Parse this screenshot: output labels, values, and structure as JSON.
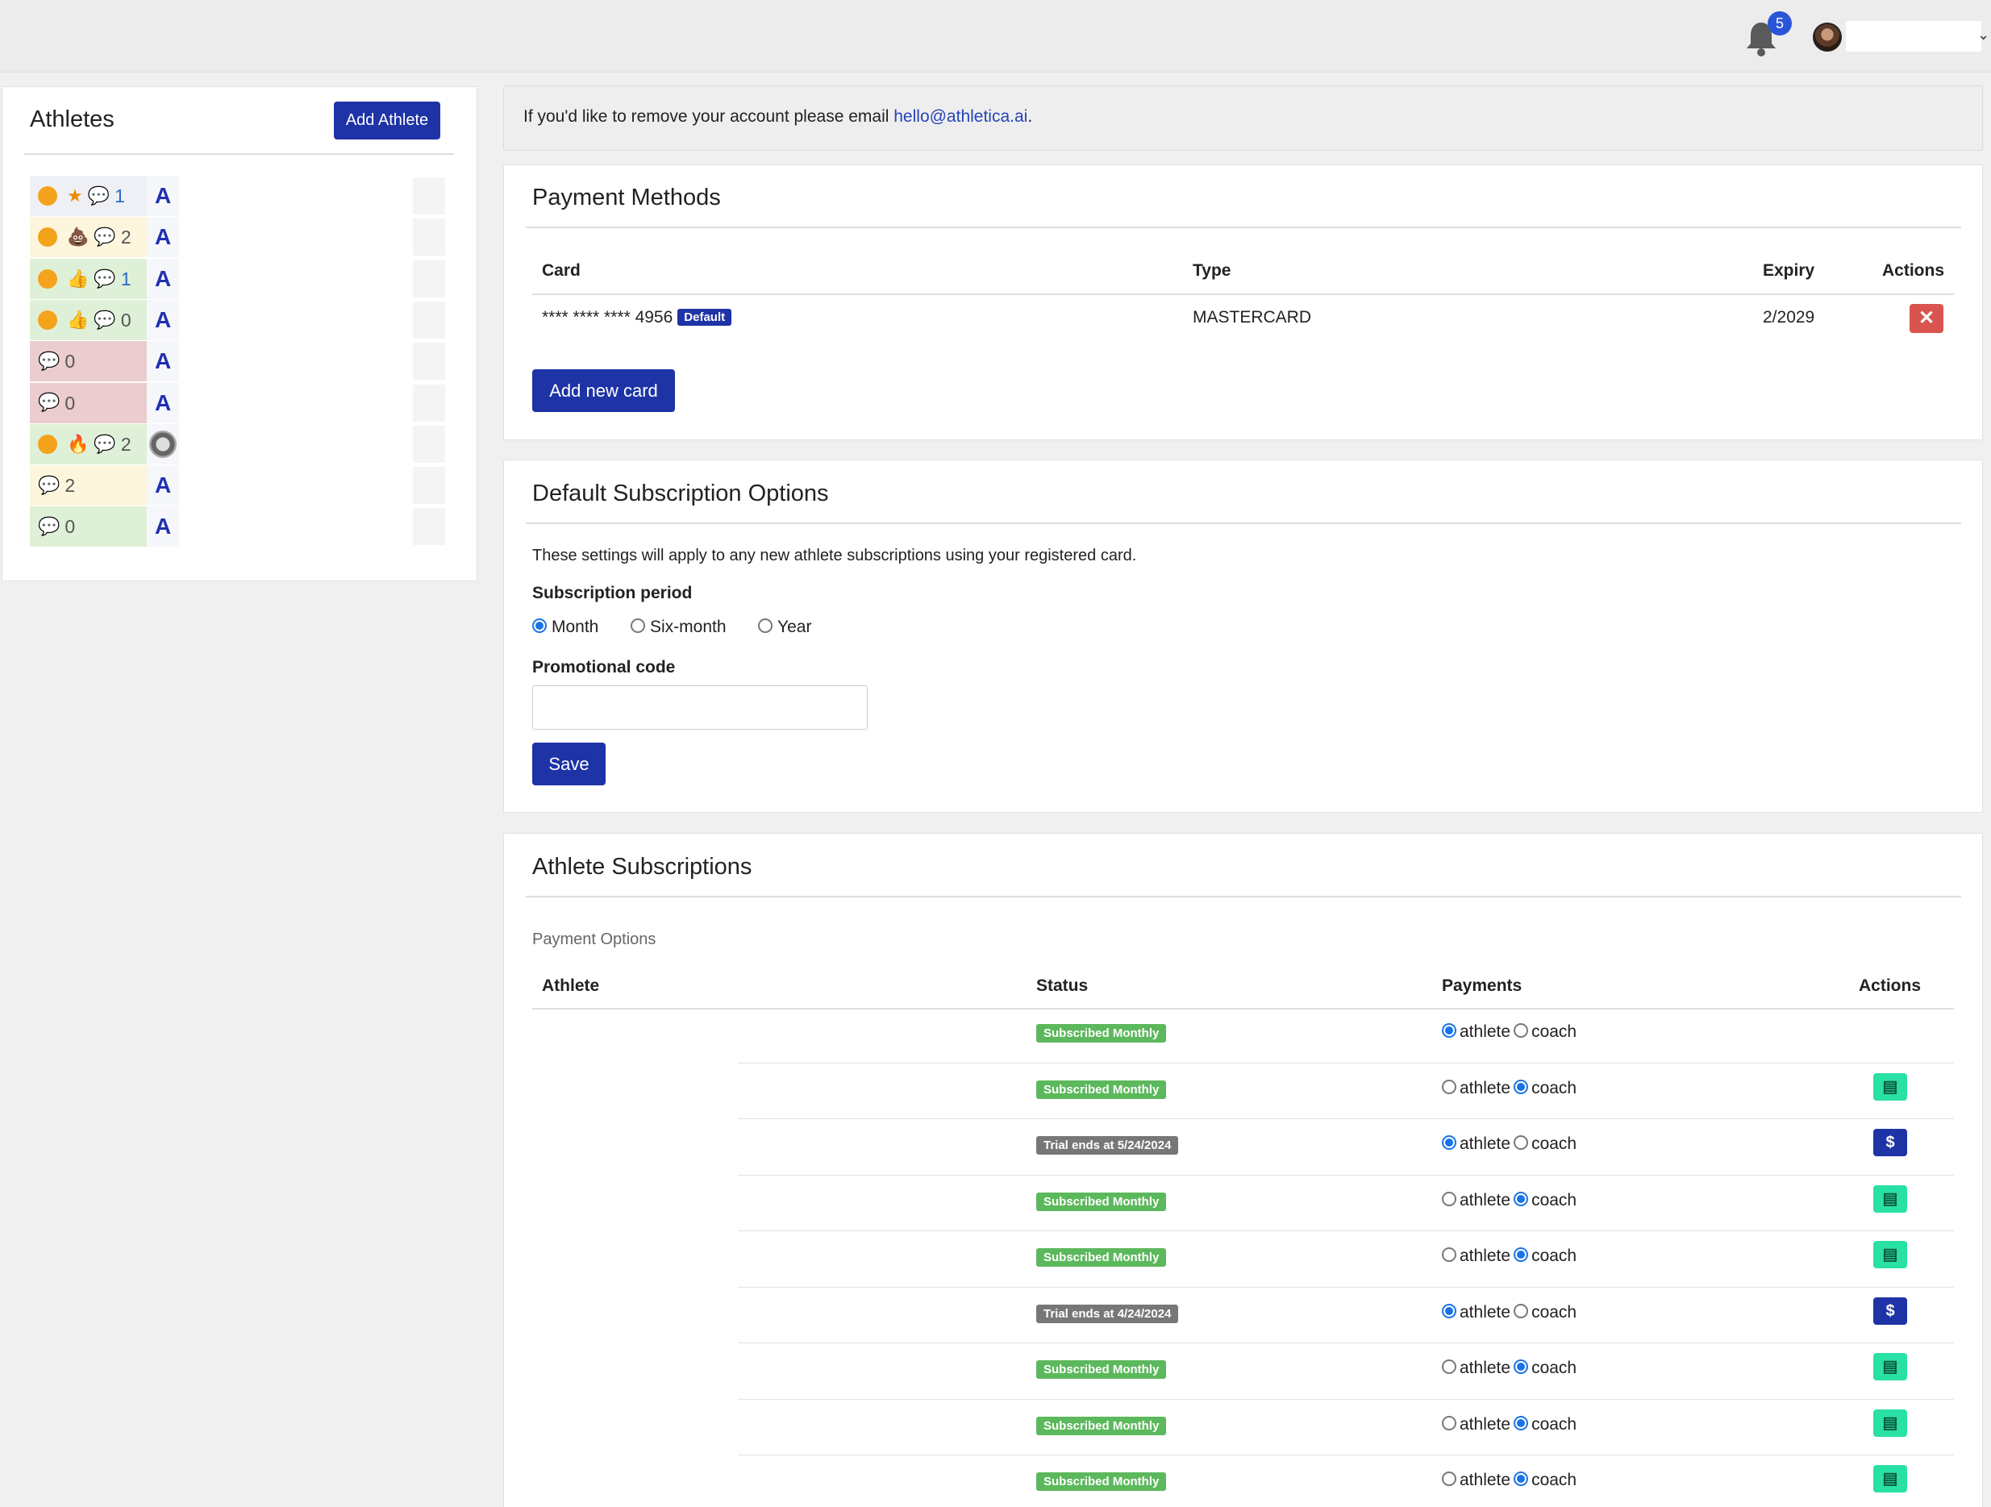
{
  "topbar": {
    "notifications_count": "5"
  },
  "sidebar": {
    "title": "Athletes",
    "add_button": "Add Athlete",
    "rows": [
      {
        "count": "1",
        "bg": "#eef0f6"
      },
      {
        "count": "2",
        "bg": "#fdf6dd"
      },
      {
        "count": "1",
        "bg": "#dff0d8"
      },
      {
        "count": "0",
        "bg": "#dff0d8"
      },
      {
        "count": "0",
        "bg": "#ebcccf"
      },
      {
        "count": "0",
        "bg": "#ebcccf"
      },
      {
        "count": "2",
        "bg": "#dff0d8"
      },
      {
        "count": "2",
        "bg": "#fdf6dd"
      },
      {
        "count": "0",
        "bg": "#dff0d8"
      }
    ]
  },
  "alert": {
    "text": "If you'd like to remove your account please email ",
    "email": "hello@athletica.ai",
    "suffix": "."
  },
  "payment_methods": {
    "title": "Payment Methods",
    "headers": {
      "card": "Card",
      "type": "Type",
      "expiry": "Expiry",
      "actions": "Actions"
    },
    "card_number": "**** **** **** 4956",
    "default_badge": "Default",
    "card_type": "MASTERCARD",
    "expiry": "2/2029",
    "add_card": "Add new card"
  },
  "default_subscription": {
    "title": "Default Subscription Options",
    "description": "These settings will apply to any new athlete subscriptions using your registered card.",
    "period_label": "Subscription period",
    "options": [
      "Month",
      "Six-month",
      "Year"
    ],
    "selected": "Month",
    "promo_label": "Promotional code",
    "promo_value": "",
    "save": "Save"
  },
  "athlete_subscriptions": {
    "title": "Athlete Subscriptions",
    "subtitle": "Payment Options",
    "headers": {
      "athlete": "Athlete",
      "status": "Status",
      "payments": "Payments",
      "actions": "Actions"
    },
    "payment_labels": {
      "athlete": "athlete",
      "coach": "coach"
    },
    "rows": [
      {
        "status": "Subscribed Monthly",
        "kind": "sub",
        "payer": "athlete",
        "action": "none"
      },
      {
        "status": "Subscribed Monthly",
        "kind": "sub",
        "payer": "coach",
        "action": "doc"
      },
      {
        "status": "Trial ends at 5/24/2024",
        "kind": "trial",
        "payer": "athlete",
        "action": "pay"
      },
      {
        "status": "Subscribed Monthly",
        "kind": "sub",
        "payer": "coach",
        "action": "doc"
      },
      {
        "status": "Subscribed Monthly",
        "kind": "sub",
        "payer": "coach",
        "action": "doc"
      },
      {
        "status": "Trial ends at 4/24/2024",
        "kind": "trial",
        "payer": "athlete",
        "action": "pay"
      },
      {
        "status": "Subscribed Monthly",
        "kind": "sub",
        "payer": "coach",
        "action": "doc"
      },
      {
        "status": "Subscribed Monthly",
        "kind": "sub",
        "payer": "coach",
        "action": "doc"
      },
      {
        "status": "Subscribed Monthly",
        "kind": "sub",
        "payer": "coach",
        "action": "doc"
      }
    ]
  },
  "colors": {
    "primary": "#1d33a6",
    "danger": "#d9534f",
    "success": "#5cb85c",
    "teal": "#29e0a5"
  }
}
